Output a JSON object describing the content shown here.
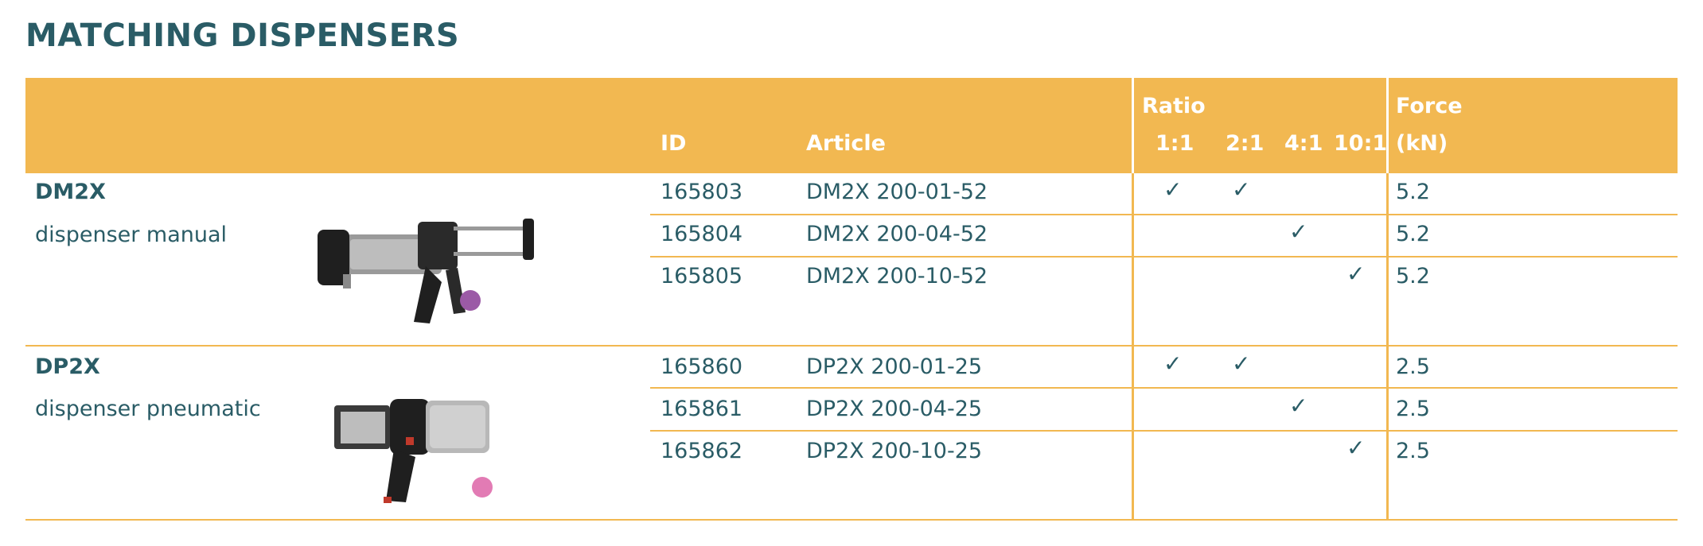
{
  "title": "MATCHING DISPENSERS",
  "columns": {
    "id": "ID",
    "article": "Article",
    "ratio": "Ratio",
    "ratio_values": [
      "1:1",
      "2:1",
      "4:1",
      "10:1"
    ],
    "force_line1": "Force",
    "force_line2": "(kN)"
  },
  "check_symbol": "✓",
  "groups": [
    {
      "name": "DM2X",
      "description": "dispenser manual",
      "dot_color": "#9b5aa6",
      "rows": [
        {
          "id": "165803",
          "article": "DM2X 200-01-52",
          "ratios": [
            true,
            true,
            false,
            false
          ],
          "force": "5.2"
        },
        {
          "id": "165804",
          "article": "DM2X 200-04-52",
          "ratios": [
            false,
            false,
            true,
            false
          ],
          "force": "5.2"
        },
        {
          "id": "165805",
          "article": "DM2X 200-10-52",
          "ratios": [
            false,
            false,
            false,
            true
          ],
          "force": "5.2"
        }
      ]
    },
    {
      "name": "DP2X",
      "description": "dispenser pneumatic",
      "dot_color": "#e27bb4",
      "rows": [
        {
          "id": "165860",
          "article": "DP2X 200-01-25",
          "ratios": [
            true,
            true,
            false,
            false
          ],
          "force": "2.5"
        },
        {
          "id": "165861",
          "article": "DP2X 200-04-25",
          "ratios": [
            false,
            false,
            true,
            false
          ],
          "force": "2.5"
        },
        {
          "id": "165862",
          "article": "DP2X 200-10-25",
          "ratios": [
            false,
            false,
            false,
            true
          ],
          "force": "2.5"
        }
      ]
    }
  ]
}
